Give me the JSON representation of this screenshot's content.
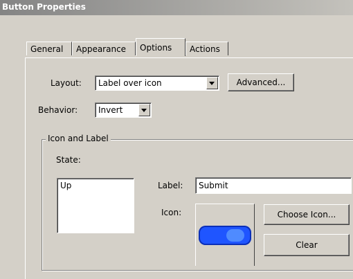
{
  "dialog": {
    "title": "Button Properties"
  },
  "tabs": [
    {
      "label": "General"
    },
    {
      "label": "Appearance"
    },
    {
      "label": "Options",
      "active": true
    },
    {
      "label": "Actions"
    }
  ],
  "options": {
    "layout_label": "Layout:",
    "layout_value": "Label over icon",
    "advanced_button": "Advanced...",
    "behavior_label": "Behavior:",
    "behavior_value": "Invert",
    "group_title": "Icon and Label",
    "state_label": "State:",
    "state_items": [
      "Up"
    ],
    "label_field_label": "Label:",
    "label_field_value": "Submit",
    "icon_label": "Icon:",
    "choose_icon_button": "Choose Icon...",
    "clear_button": "Clear",
    "icon_preview": {
      "name": "blue-pill-button-icon",
      "color_primary": "#1f55ff",
      "color_highlight": "#4f8bff"
    }
  }
}
